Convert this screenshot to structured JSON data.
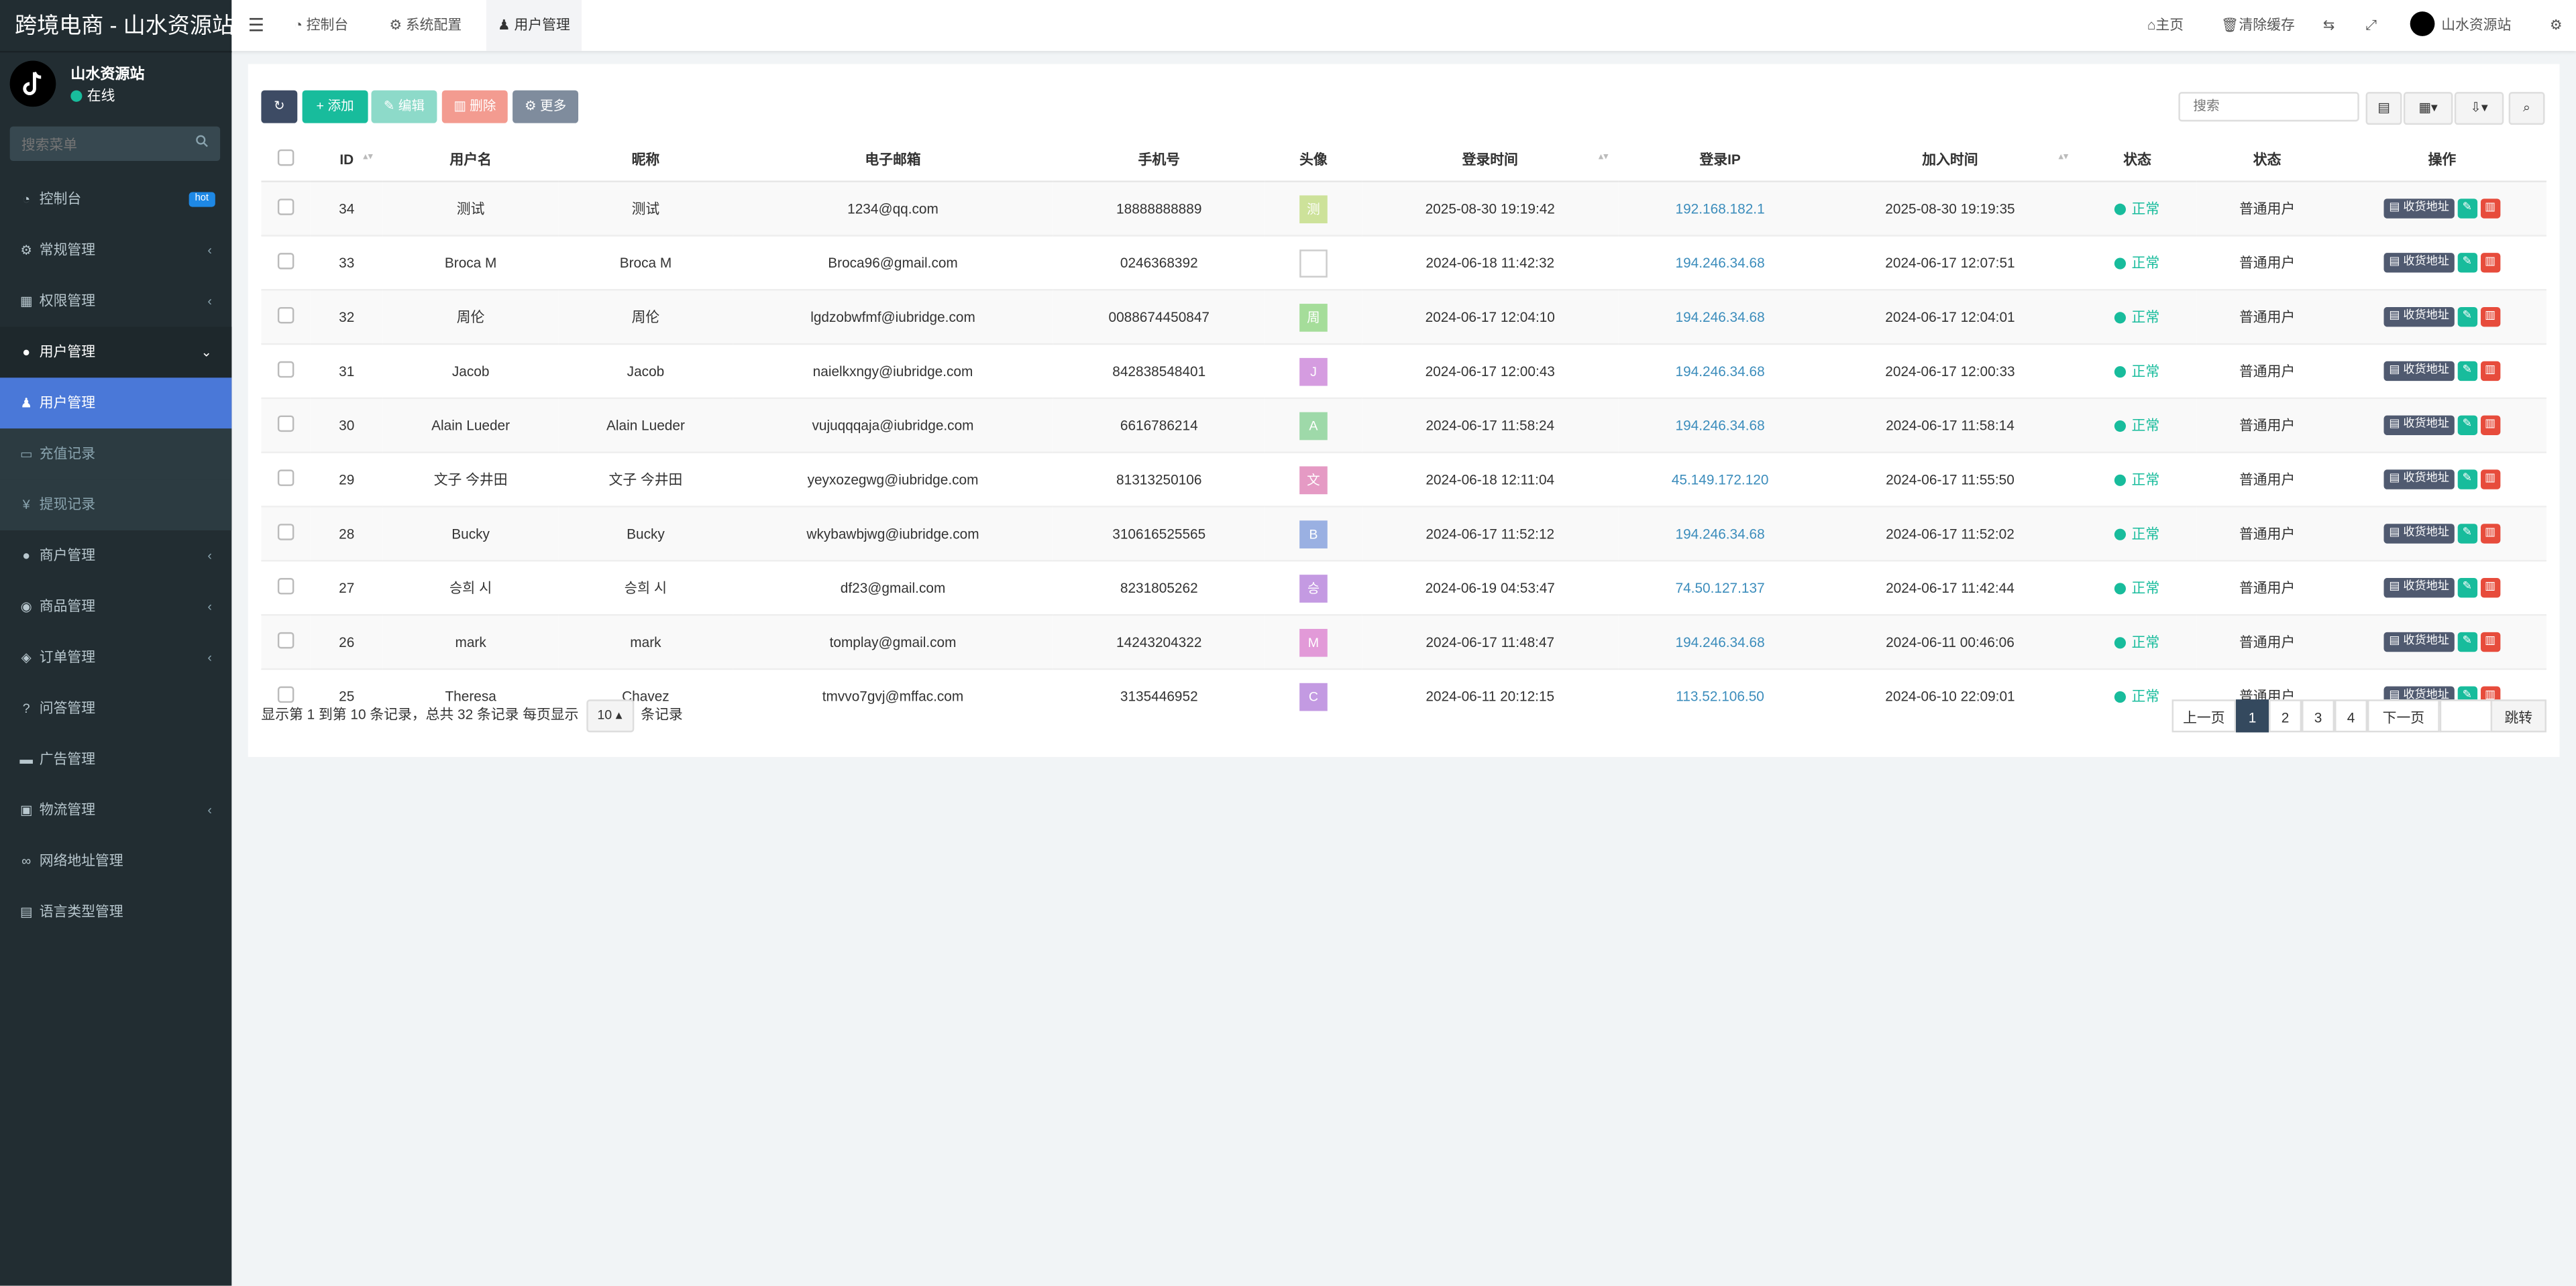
{
  "app": {
    "title": "跨境电商 - 山水资源站"
  },
  "user": {
    "name": "山水资源站",
    "status": "在线"
  },
  "sidebar": {
    "search_placeholder": "搜索菜单",
    "items": [
      {
        "label": "控制台",
        "icon": "dashboard-icon",
        "badge": "hot"
      },
      {
        "label": "常规管理",
        "icon": "cogs-icon"
      },
      {
        "label": "权限管理",
        "icon": "group-icon"
      },
      {
        "label": "用户管理",
        "icon": "user-circle-icon"
      },
      {
        "label": "用户管理",
        "icon": "user-icon"
      },
      {
        "label": "充值记录",
        "icon": "money-icon"
      },
      {
        "label": "提现记录",
        "icon": "yen-icon"
      },
      {
        "label": "商户管理",
        "icon": "apple-icon"
      },
      {
        "label": "商品管理",
        "icon": "product-icon"
      },
      {
        "label": "订单管理",
        "icon": "order-icon"
      },
      {
        "label": "问答管理",
        "icon": "question-icon"
      },
      {
        "label": "广告管理",
        "icon": "ad-icon"
      },
      {
        "label": "物流管理",
        "icon": "truck-icon"
      },
      {
        "label": "网络地址管理",
        "icon": "link-icon"
      },
      {
        "label": "语言类型管理",
        "icon": "language-icon"
      }
    ]
  },
  "header": {
    "tabs": [
      {
        "label": "控制台",
        "icon": "dashboard-icon"
      },
      {
        "label": "系统配置",
        "icon": "gear-icon"
      },
      {
        "label": "用户管理",
        "icon": "user-icon"
      }
    ],
    "home": "主页",
    "clear_cache": "清除缓存",
    "username": "山水资源站"
  },
  "toolbar": {
    "add": "添加",
    "edit": "编辑",
    "delete": "删除",
    "more": "更多",
    "search_placeholder": "搜索"
  },
  "table": {
    "columns": [
      "ID",
      "用户名",
      "昵称",
      "电子邮箱",
      "手机号",
      "头像",
      "登录时间",
      "登录IP",
      "加入时间",
      "状态",
      "状态",
      "操作"
    ],
    "action_label": "收货地址",
    "rows": [
      {
        "id": "34",
        "username": "测试",
        "nickname": "测试",
        "email": "1234@qq.com",
        "phone": "18888888889",
        "avatar": "测",
        "avatar_color": "#cde29a",
        "login_time": "2025-08-30 19:19:42",
        "ip": "192.168.182.1",
        "join_time": "2025-08-30 19:19:35",
        "status": "正常",
        "group": "普通用户"
      },
      {
        "id": "33",
        "username": "Broca M",
        "nickname": "Broca M",
        "email": "Broca96@gmail.com",
        "phone": "0246368392",
        "avatar": "",
        "avatar_color": "#ffffff",
        "login_time": "2024-06-18 11:42:32",
        "ip": "194.246.34.68",
        "join_time": "2024-06-17 12:07:51",
        "status": "正常",
        "group": "普通用户"
      },
      {
        "id": "32",
        "username": "周伦",
        "nickname": "周伦",
        "email": "lgdzobwfmf@iubridge.com",
        "phone": "0088674450847",
        "avatar": "周",
        "avatar_color": "#a5dd9a",
        "login_time": "2024-06-17 12:04:10",
        "ip": "194.246.34.68",
        "join_time": "2024-06-17 12:04:01",
        "status": "正常",
        "group": "普通用户"
      },
      {
        "id": "31",
        "username": "Jacob",
        "nickname": "Jacob",
        "email": "naielkxngy@iubridge.com",
        "phone": "842838548401",
        "avatar": "J",
        "avatar_color": "#d59ce0",
        "login_time": "2024-06-17 12:00:43",
        "ip": "194.246.34.68",
        "join_time": "2024-06-17 12:00:33",
        "status": "正常",
        "group": "普通用户"
      },
      {
        "id": "30",
        "username": "Alain Lueder",
        "nickname": "Alain Lueder",
        "email": "vujuqqqaja@iubridge.com",
        "phone": "6616786214",
        "avatar": "A",
        "avatar_color": "#9ed9a9",
        "login_time": "2024-06-17 11:58:24",
        "ip": "194.246.34.68",
        "join_time": "2024-06-17 11:58:14",
        "status": "正常",
        "group": "普通用户"
      },
      {
        "id": "29",
        "username": "文子 今井田",
        "nickname": "文子 今井田",
        "email": "yeyxozegwg@iubridge.com",
        "phone": "81313250106",
        "avatar": "文",
        "avatar_color": "#e59ac4",
        "login_time": "2024-06-18 12:11:04",
        "ip": "45.149.172.120",
        "join_time": "2024-06-17 11:55:50",
        "status": "正常",
        "group": "普通用户"
      },
      {
        "id": "28",
        "username": "Bucky",
        "nickname": "Bucky",
        "email": "wkybawbjwg@iubridge.com",
        "phone": "310616525565",
        "avatar": "B",
        "avatar_color": "#9ab0e2",
        "login_time": "2024-06-17 11:52:12",
        "ip": "194.246.34.68",
        "join_time": "2024-06-17 11:52:02",
        "status": "正常",
        "group": "普通用户"
      },
      {
        "id": "27",
        "username": "승희 시",
        "nickname": "승희 시",
        "email": "df23@gmail.com",
        "phone": "8231805262",
        "avatar": "승",
        "avatar_color": "#c49ae2",
        "login_time": "2024-06-19 04:53:47",
        "ip": "74.50.127.137",
        "join_time": "2024-06-17 11:42:44",
        "status": "正常",
        "group": "普通用户"
      },
      {
        "id": "26",
        "username": "mark",
        "nickname": "mark",
        "email": "tomplay@gmail.com",
        "phone": "14243204322",
        "avatar": "M",
        "avatar_color": "#e29ad8",
        "login_time": "2024-06-17 11:48:47",
        "ip": "194.246.34.68",
        "join_time": "2024-06-11 00:46:06",
        "status": "正常",
        "group": "普通用户"
      },
      {
        "id": "25",
        "username": "Theresa",
        "nickname": "Chavez",
        "email": "tmvvo7gvj@mffac.com",
        "phone": "3135446952",
        "avatar": "C",
        "avatar_color": "#c39ae2",
        "login_time": "2024-06-11 20:12:15",
        "ip": "113.52.106.50",
        "join_time": "2024-06-10 22:09:01",
        "status": "正常",
        "group": "普通用户"
      }
    ]
  },
  "pagination": {
    "info_prefix": "显示第 1 到第 10 条记录，总共 32 条记录 每页显示",
    "page_size": "10",
    "info_suffix": "条记录",
    "prev": "上一页",
    "pages": [
      "1",
      "2",
      "3",
      "4"
    ],
    "next": "下一页",
    "jump": "跳转"
  },
  "colors": {
    "sidebar_bg": "#222d32",
    "active_item": "#4a78d8",
    "primary_dark": "#3d4b64",
    "success": "#18bc9c",
    "danger": "#e74c3c"
  }
}
